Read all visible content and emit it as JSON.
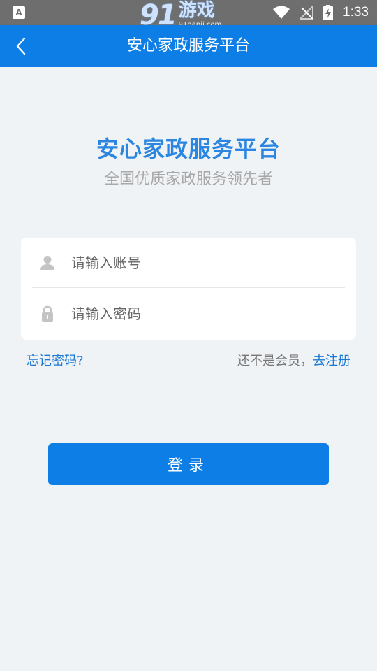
{
  "status_bar": {
    "left_icon_letter": "A",
    "time": "1:33",
    "watermark": {
      "num": "91",
      "cn": "游戏",
      "url": "91danji.com"
    }
  },
  "app_bar": {
    "title": "安心家政服务平台"
  },
  "hero": {
    "title": "安心家政服务平台",
    "subtitle": "全国优质家政服务领先者"
  },
  "form": {
    "account_placeholder": "请输入账号",
    "password_placeholder": "请输入密码"
  },
  "links": {
    "forgot_password": "忘记密码?",
    "register_prompt": "还不是会员，",
    "register_link": "去注册"
  },
  "login_button": {
    "label": "登录"
  },
  "colors": {
    "primary": "#0d7ee5",
    "hero_title": "#2a86e0",
    "link": "#1a78d2",
    "background": "#f0f3f6"
  },
  "icons": [
    "back-chevron-icon",
    "user-icon",
    "lock-icon",
    "wifi-icon",
    "no-signal-icon",
    "battery-charging-icon"
  ]
}
